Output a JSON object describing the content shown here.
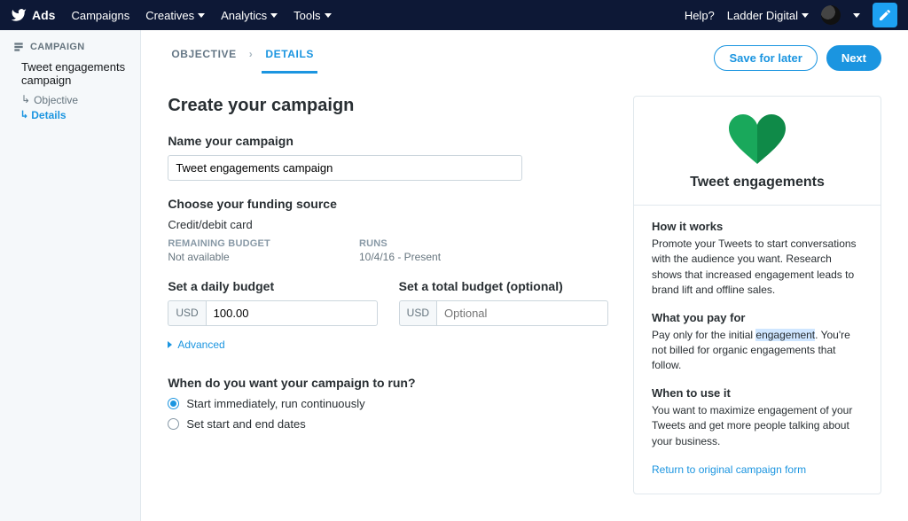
{
  "topbar": {
    "brand": "Ads",
    "nav": {
      "campaigns": "Campaigns",
      "creatives": "Creatives",
      "analytics": "Analytics",
      "tools": "Tools"
    },
    "help": "Help?",
    "account": "Ladder Digital"
  },
  "sidebar": {
    "section": "CAMPAIGN",
    "campaign_name": "Tweet engagements campaign",
    "steps": {
      "objective": "Objective",
      "details": "Details"
    }
  },
  "tabs": {
    "objective": "OBJECTIVE",
    "details": "DETAILS"
  },
  "actions": {
    "save": "Save for later",
    "next": "Next"
  },
  "form": {
    "page_title": "Create your campaign",
    "name_label": "Name your campaign",
    "name_value": "Tweet engagements campaign",
    "funding_label": "Choose your funding source",
    "funding_value": "Credit/debit card",
    "remaining_label": "REMAINING BUDGET",
    "remaining_value": "Not available",
    "runs_label": "RUNS",
    "runs_value": "10/4/16 - Present",
    "daily_label": "Set a daily budget",
    "total_label": "Set a total budget (optional)",
    "currency": "USD",
    "daily_value": "100.00",
    "total_placeholder": "Optional",
    "advanced": "Advanced",
    "schedule_label": "When do you want your campaign to run?",
    "schedule_opt1": "Start immediately, run continuously",
    "schedule_opt2": "Set start and end dates"
  },
  "info": {
    "title": "Tweet engagements",
    "how_title": "How it works",
    "how_body": "Promote your Tweets to start conversations with the audience you want. Research shows that increased engagement leads to brand lift and offline sales.",
    "pay_title": "What you pay for",
    "pay_body_pre": "Pay only for the initial ",
    "pay_body_hl": "engagement",
    "pay_body_post": ". You're not billed for organic engagements that follow.",
    "when_title": "When to use it",
    "when_body": "You want to maximize engagement of your Tweets and get more people talking about your business.",
    "return_link": "Return to original campaign form"
  }
}
